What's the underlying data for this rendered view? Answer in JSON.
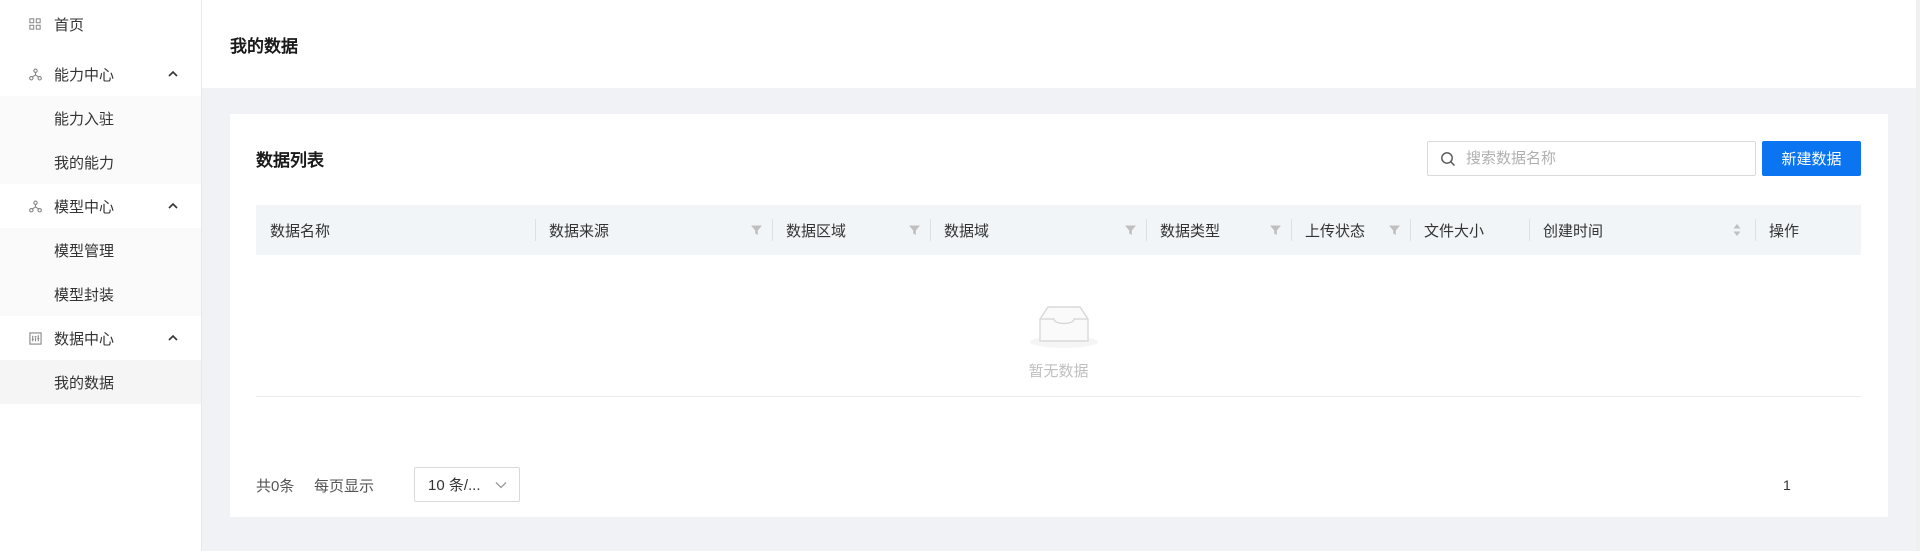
{
  "sidebar": {
    "home": {
      "label": "首页",
      "icon": "grid-icon"
    },
    "groups": [
      {
        "label": "能力中心",
        "icon": "branch-icon",
        "items": [
          "能力入驻",
          "我的能力"
        ]
      },
      {
        "label": "模型中心",
        "icon": "branch-icon",
        "items": [
          "模型管理",
          "模型封装"
        ]
      },
      {
        "label": "数据中心",
        "icon": "data-icon",
        "items": [
          "我的数据"
        ]
      }
    ],
    "active_item": "我的数据"
  },
  "header": {
    "title": "我的数据"
  },
  "card": {
    "title": "数据列表",
    "search_placeholder": "搜索数据名称",
    "new_button": "新建数据"
  },
  "table": {
    "columns": [
      {
        "label": "数据名称",
        "control": "none"
      },
      {
        "label": "数据来源",
        "control": "filter"
      },
      {
        "label": "数据区域",
        "control": "filter"
      },
      {
        "label": "数据域",
        "control": "filter"
      },
      {
        "label": "数据类型",
        "control": "filter"
      },
      {
        "label": "上传状态",
        "control": "filter"
      },
      {
        "label": "文件大小",
        "control": "none"
      },
      {
        "label": "创建时间",
        "control": "sort"
      },
      {
        "label": "操作",
        "control": "none"
      }
    ],
    "rows": [],
    "empty_text": "暂无数据"
  },
  "pagination": {
    "total": "共0条",
    "per_page_label": "每页显示",
    "page_size": "10 条/...",
    "current_page": "1"
  },
  "colors": {
    "primary": "#0b74f0",
    "header_bg": "#f2f5f8",
    "page_bg": "#f0f2f5"
  }
}
